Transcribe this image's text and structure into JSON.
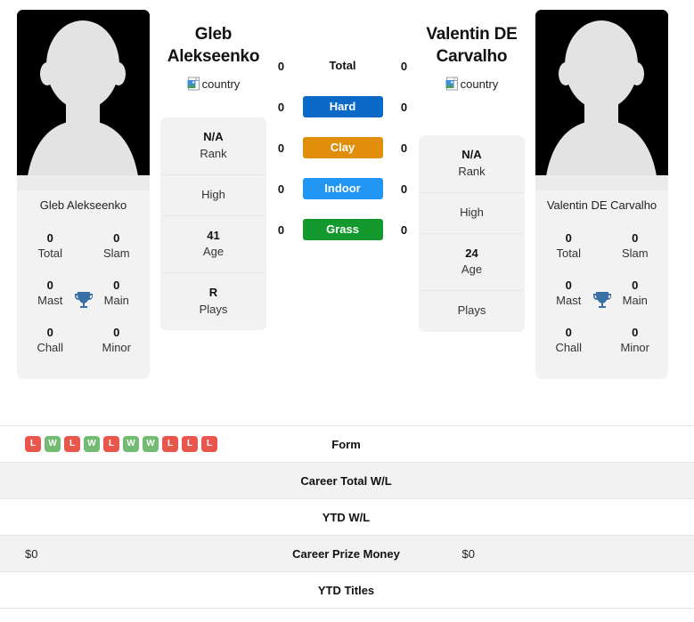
{
  "players": {
    "left": {
      "name": "Gleb Alekseenko",
      "name_lines": [
        "Gleb",
        "Alekseenko"
      ],
      "photo_caption": "Gleb Alekseenko",
      "country_alt": "country",
      "meta": [
        {
          "value": "N/A",
          "label": "Rank"
        },
        {
          "value": "",
          "label": "High"
        },
        {
          "value": "41",
          "label": "Age"
        },
        {
          "value": "R",
          "label": "Plays"
        }
      ],
      "titles": [
        {
          "value": "0",
          "label": "Total"
        },
        {
          "value": "0",
          "label": "Slam"
        },
        {
          "value": "0",
          "label": "Mast"
        },
        {
          "value": "0",
          "label": "Main"
        },
        {
          "value": "0",
          "label": "Chall"
        },
        {
          "value": "0",
          "label": "Minor"
        }
      ],
      "surface_values": {
        "total": "0",
        "hard": "0",
        "clay": "0",
        "indoor": "0",
        "grass": "0"
      },
      "form": [
        "L",
        "W",
        "L",
        "W",
        "L",
        "W",
        "W",
        "L",
        "L",
        "L"
      ],
      "career_total_wl": "",
      "ytd_wl": "",
      "career_prize_money": "$0",
      "ytd_titles": ""
    },
    "right": {
      "name": "Valentin DE Carvalho",
      "name_lines": [
        "Valentin DE",
        "Carvalho"
      ],
      "photo_caption": "Valentin DE Carvalho",
      "country_alt": "country",
      "meta": [
        {
          "value": "N/A",
          "label": "Rank"
        },
        {
          "value": "",
          "label": "High"
        },
        {
          "value": "24",
          "label": "Age"
        },
        {
          "value": "",
          "label": "Plays"
        }
      ],
      "titles": [
        {
          "value": "0",
          "label": "Total"
        },
        {
          "value": "0",
          "label": "Slam"
        },
        {
          "value": "0",
          "label": "Mast"
        },
        {
          "value": "0",
          "label": "Main"
        },
        {
          "value": "0",
          "label": "Chall"
        },
        {
          "value": "0",
          "label": "Minor"
        }
      ],
      "surface_values": {
        "total": "0",
        "hard": "0",
        "clay": "0",
        "indoor": "0",
        "grass": "0"
      },
      "form": [],
      "career_total_wl": "",
      "ytd_wl": "",
      "career_prize_money": "$0",
      "ytd_titles": ""
    }
  },
  "surfaces": [
    {
      "key": "total",
      "label": "Total",
      "color": "transparent",
      "plain": true
    },
    {
      "key": "hard",
      "label": "Hard",
      "color": "#0b69c7",
      "plain": false
    },
    {
      "key": "clay",
      "label": "Clay",
      "color": "#e08e0b",
      "plain": false
    },
    {
      "key": "indoor",
      "label": "Indoor",
      "color": "#2196f3",
      "plain": false
    },
    {
      "key": "grass",
      "label": "Grass",
      "color": "#14992f",
      "plain": false
    }
  ],
  "stats_rows": [
    {
      "key": "form",
      "label": "Form",
      "shaded": false
    },
    {
      "key": "career_total_wl",
      "label": "Career Total W/L",
      "shaded": true
    },
    {
      "key": "ytd_wl",
      "label": "YTD W/L",
      "shaded": false
    },
    {
      "key": "career_prize_money",
      "label": "Career Prize Money",
      "shaded": true
    },
    {
      "key": "ytd_titles",
      "label": "YTD Titles",
      "shaded": false
    }
  ],
  "colors": {
    "win_badge": "#72bb72",
    "loss_badge": "#e8564c",
    "card_bg": "#f2f2f2",
    "trophy": "#3b6fa8",
    "avatar_bg": "#000000",
    "avatar_fill": "#e3e3e3"
  },
  "icons": {
    "trophy": "trophy-icon",
    "broken_image": "broken-image-icon",
    "avatar": "person-silhouette-icon"
  }
}
